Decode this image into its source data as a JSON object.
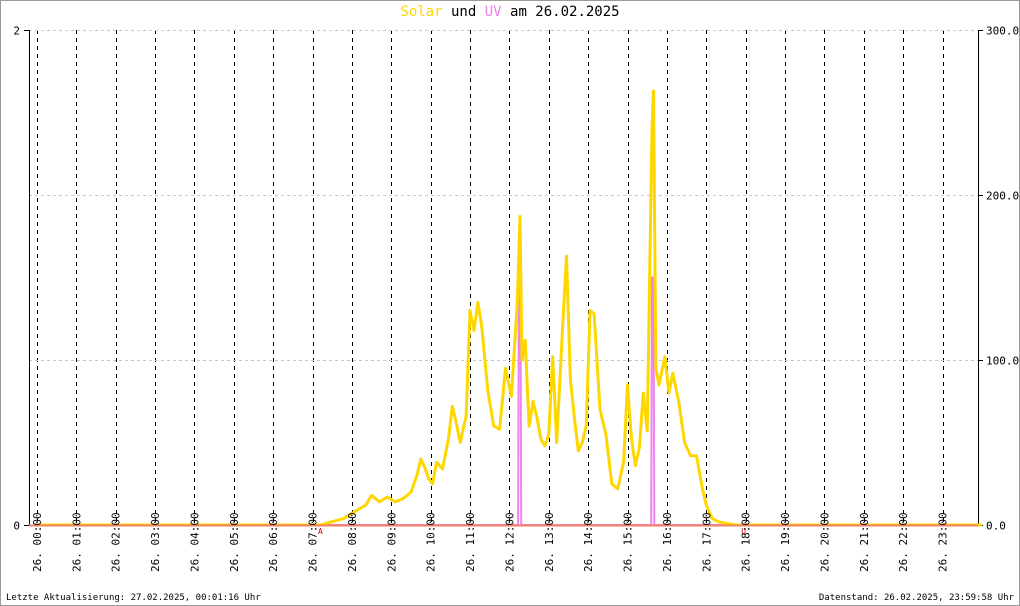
{
  "title": {
    "solar": "Solar",
    "und": "und",
    "uv": "UV",
    "date": "am 26.02.2025"
  },
  "footer": {
    "updated": "Letzte Aktualisierung: 27.02.2025, 00:01:16 Uhr",
    "data_state": "Datenstand: 26.02.2025, 23:59:58 Uhr"
  },
  "colors": {
    "solar": "#ffd700",
    "uv": "#ee82ee",
    "marker": "#cc0000"
  },
  "chart_data": {
    "type": "line",
    "title": "Solar und UV am 26.02.2025",
    "x_range_hours": [
      -0.2,
      23.9
    ],
    "x_ticks": [
      "26. 00:00",
      "26. 01:00",
      "26. 02:00",
      "26. 03:00",
      "26. 04:00",
      "26. 05:00",
      "26. 06:00",
      "26. 07:00",
      "26. 08:00",
      "26. 09:00",
      "26. 10:00",
      "26. 11:00",
      "26. 12:00",
      "26. 13:00",
      "26. 14:00",
      "26. 15:00",
      "26. 16:00",
      "26. 17:00",
      "26. 18:00",
      "26. 19:00",
      "26. 20:00",
      "26. 21:00",
      "26. 22:00",
      "26. 23:00"
    ],
    "y_left": {
      "ylim": [
        0,
        2
      ],
      "ticks": [
        "0",
        "2"
      ]
    },
    "y_right": {
      "ylim": [
        0,
        300
      ],
      "ticks": [
        "0.0",
        "100.0",
        "200.0",
        "300.0"
      ]
    },
    "grid": true,
    "markers": [
      {
        "hour": 7.2,
        "label": "A"
      },
      {
        "hour": 17.95,
        "label": "U"
      }
    ],
    "series": [
      {
        "name": "Solar",
        "axis": "right",
        "x": [
          0,
          7.2,
          7.5,
          7.8,
          8.0,
          8.2,
          8.35,
          8.5,
          8.7,
          8.9,
          9.1,
          9.3,
          9.5,
          9.65,
          9.75,
          9.85,
          9.95,
          10.05,
          10.15,
          10.3,
          10.45,
          10.55,
          10.65,
          10.75,
          10.9,
          11.0,
          11.1,
          11.2,
          11.3,
          11.45,
          11.6,
          11.75,
          11.9,
          12.05,
          12.2,
          12.27,
          12.32,
          12.4,
          12.5,
          12.6,
          12.7,
          12.8,
          12.9,
          13.0,
          13.1,
          13.2,
          13.35,
          13.45,
          13.55,
          13.65,
          13.75,
          13.85,
          13.95,
          14.05,
          14.15,
          14.3,
          14.45,
          14.6,
          14.75,
          14.9,
          15.0,
          15.1,
          15.2,
          15.3,
          15.4,
          15.5,
          15.62,
          15.66,
          15.72,
          15.8,
          15.95,
          16.05,
          16.15,
          16.3,
          16.45,
          16.6,
          16.75,
          16.9,
          17.0,
          17.15,
          17.3,
          17.5,
          17.75,
          17.95,
          24
        ],
        "values": [
          0,
          0,
          2,
          4,
          7,
          10,
          12,
          18,
          14,
          17,
          14,
          16,
          20,
          30,
          40,
          35,
          28,
          25,
          38,
          34,
          52,
          72,
          62,
          50,
          66,
          130,
          118,
          135,
          120,
          82,
          60,
          58,
          95,
          78,
          135,
          187,
          100,
          112,
          60,
          75,
          65,
          52,
          48,
          55,
          102,
          50,
          120,
          163,
          88,
          65,
          45,
          50,
          60,
          130,
          128,
          70,
          55,
          25,
          22,
          38,
          85,
          52,
          36,
          47,
          80,
          57,
          240,
          263,
          95,
          85,
          102,
          80,
          92,
          75,
          50,
          42,
          42,
          22,
          12,
          4,
          2,
          1,
          0,
          0,
          0
        ]
      },
      {
        "name": "UV",
        "axis": "left",
        "x": [
          0,
          12.22,
          12.24,
          12.28,
          12.3,
          15.6,
          15.62,
          15.66,
          15.68,
          24
        ],
        "values": [
          0,
          0,
          1.0,
          1.0,
          0,
          0,
          1.0,
          1.0,
          0,
          0
        ]
      }
    ]
  }
}
